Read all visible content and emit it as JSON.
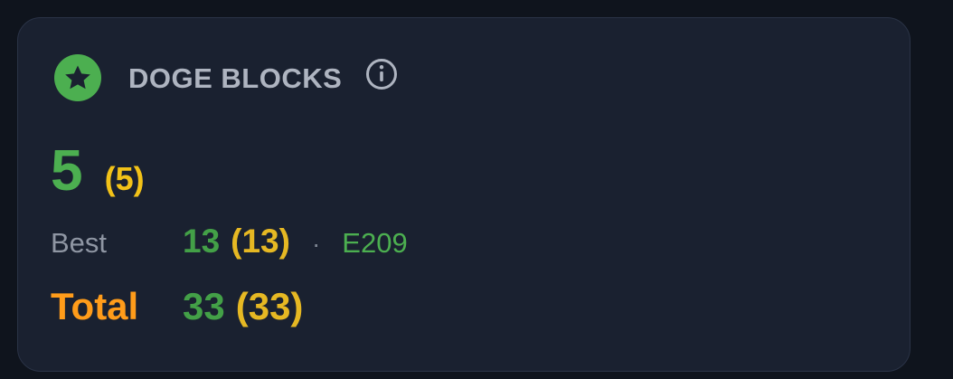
{
  "card": {
    "title": "DOGE BLOCKS",
    "icons": {
      "badge": "star-icon",
      "info": "info-icon"
    },
    "current": {
      "value": "5",
      "secondary": "(5)"
    },
    "best": {
      "label": "Best",
      "value": "13",
      "secondary": "(13)",
      "separator": "·",
      "epoch": "E209"
    },
    "total": {
      "label": "Total",
      "value": "33",
      "secondary": "(33)"
    }
  },
  "colors": {
    "page_background": "#0f141d",
    "card_background": "#1a2130",
    "green": "#4caf50",
    "yellow": "#f2c218",
    "orange": "#ff9c1a",
    "muted_text": "#8f96a3"
  }
}
